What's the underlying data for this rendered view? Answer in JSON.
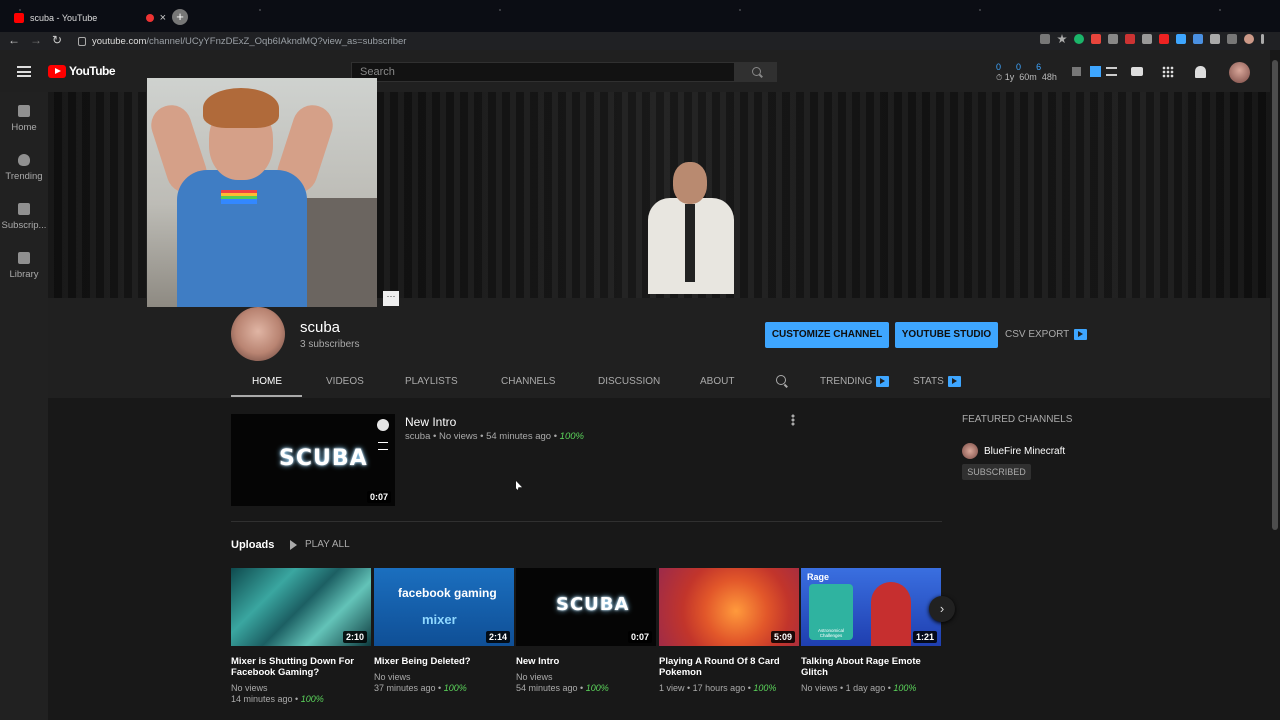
{
  "browser": {
    "tab_title": "scuba - YouTube",
    "close_glyph": "×",
    "newtab_glyph": "+",
    "url_main": "youtube.com",
    "url_rest": "/channel/UCyYFnzDExZ_Oqb6IAkndMQ?view_as=subscriber",
    "back_glyph": "←",
    "forward_glyph": "→",
    "reload_glyph": "↻"
  },
  "header": {
    "logo_text": "YouTube",
    "search_placeholder": "Search",
    "stats": {
      "a": "0",
      "b": "0",
      "c": "6",
      "d": "1y",
      "e": "60m",
      "f": "48h"
    }
  },
  "sidebar": {
    "items": [
      {
        "label": "Home"
      },
      {
        "label": "Trending"
      },
      {
        "label": "Subscrip..."
      },
      {
        "label": "Library"
      }
    ]
  },
  "webcam": {
    "button_glyph": "···"
  },
  "channel": {
    "name": "scuba",
    "subscribers": "3 subscribers",
    "customize_label": "CUSTOMIZE CHANNEL",
    "studio_label": "YOUTUBE STUDIO",
    "csv_label": "CSV EXPORT"
  },
  "tabs": [
    {
      "label": "HOME"
    },
    {
      "label": "VIDEOS"
    },
    {
      "label": "PLAYLISTS"
    },
    {
      "label": "CHANNELS"
    },
    {
      "label": "DISCUSSION"
    },
    {
      "label": "ABOUT"
    },
    {
      "label": "TRENDING"
    },
    {
      "label": "STATS"
    }
  ],
  "featured_video": {
    "thumb_text": "SCUBA",
    "duration": "0:07",
    "title": "New Intro",
    "meta": "scuba • No views • 54 minutes ago •",
    "percent": "100%"
  },
  "featured_channels": {
    "heading": "FEATURED CHANNELS",
    "channel_name": "BlueFire Minecraft",
    "subscribed_label": "SUBSCRIBED"
  },
  "uploads": {
    "title": "Uploads",
    "play_all": "PLAY ALL",
    "next_glyph": "›",
    "videos": [
      {
        "title": "Mixer is Shutting Down For Facebook Gaming?",
        "line1": "No views",
        "line2": "14 minutes ago •",
        "percent": "100%",
        "duration": "2:10"
      },
      {
        "title": "Mixer Being Deleted?",
        "line1": "No views",
        "line2": "37 minutes ago •",
        "percent": "100%",
        "duration": "2:14",
        "thumb_top": "facebook gaming",
        "thumb_bottom": "mixer"
      },
      {
        "title": "New Intro",
        "line1": "No views",
        "line2": "54 minutes ago •",
        "percent": "100%",
        "duration": "0:07",
        "thumb_text": "SCUBA"
      },
      {
        "title": "Playing A Round Of 8 Card Pokemon",
        "line1": "1 view • 17 hours ago •",
        "line2": "",
        "percent": "100%",
        "duration": "5:09"
      },
      {
        "title": "Talking About Rage Emote Glitch",
        "line1": "No views • 1 day ago •",
        "line2": "",
        "percent": "100%",
        "duration": "1:21",
        "thumb_tag": "Rage",
        "thumb_tag2": "Astronomical Challenges"
      }
    ]
  },
  "colors": {
    "accent": "#3ea6ff",
    "green": "#5bd45b",
    "bg": "#181818"
  }
}
